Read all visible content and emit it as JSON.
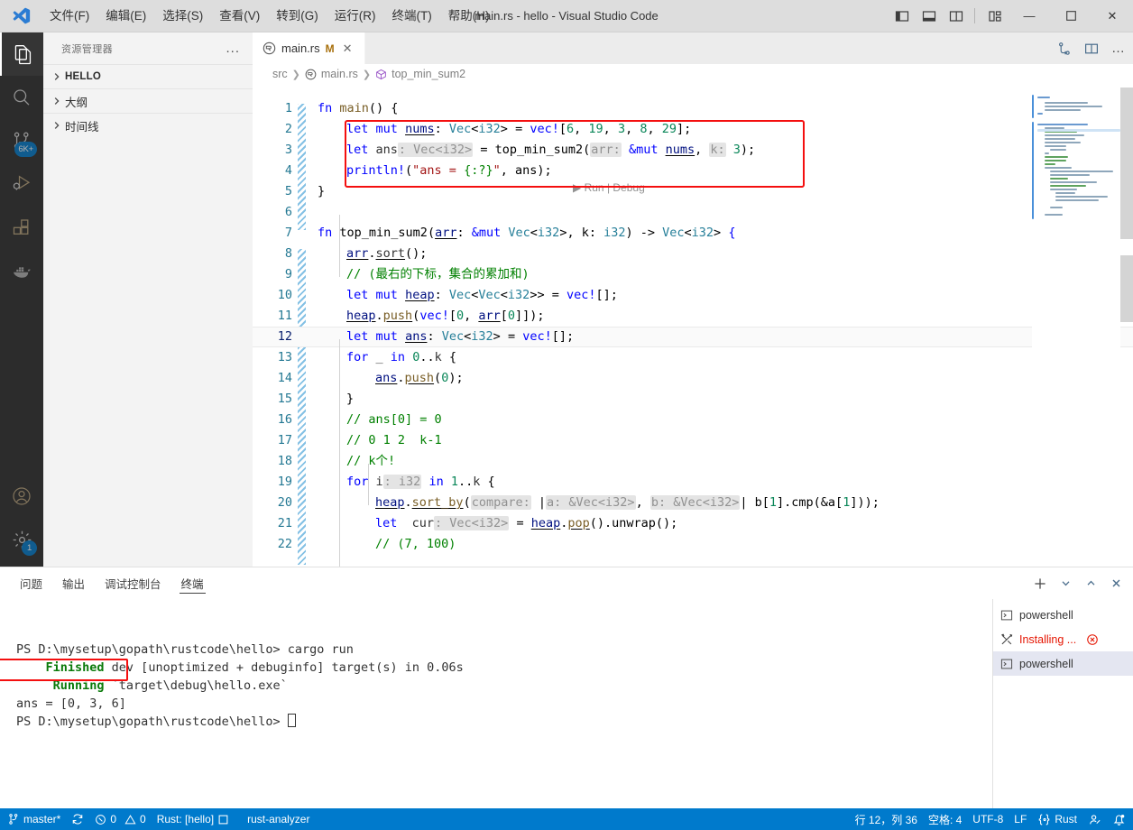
{
  "titlebar": {
    "window_title": "main.rs - hello - Visual Studio Code",
    "logo_icon": "vscode-logo-icon",
    "menus": [
      {
        "label": "文件(F)",
        "name": "menu-file"
      },
      {
        "label": "编辑(E)",
        "name": "menu-edit"
      },
      {
        "label": "选择(S)",
        "name": "menu-selection"
      },
      {
        "label": "查看(V)",
        "name": "menu-view"
      },
      {
        "label": "转到(G)",
        "name": "menu-go"
      },
      {
        "label": "运行(R)",
        "name": "menu-run"
      },
      {
        "label": "终端(T)",
        "name": "menu-terminal"
      },
      {
        "label": "帮助(H)",
        "name": "menu-help"
      }
    ],
    "layout_buttons": [
      "toggle-primary-sidebar-icon",
      "toggle-panel-icon",
      "toggle-secondary-sidebar-icon",
      "customize-layout-icon"
    ],
    "window_controls": {
      "minimize": "—",
      "maximize": "▢",
      "close": "✕"
    }
  },
  "activitybar": {
    "items": [
      {
        "name": "activity-explorer",
        "icon": "files-icon",
        "active": true
      },
      {
        "name": "activity-search",
        "icon": "search-icon",
        "active": false
      },
      {
        "name": "activity-source-control",
        "icon": "source-control-icon",
        "active": false,
        "badge": "6K+"
      },
      {
        "name": "activity-run-debug",
        "icon": "run-and-debug-icon",
        "active": false
      },
      {
        "name": "activity-extensions",
        "icon": "extensions-icon",
        "active": false
      },
      {
        "name": "activity-docker",
        "icon": "docker-whale-icon",
        "active": false
      },
      {
        "name": "activity-accounts",
        "icon": "account-icon",
        "active": false
      },
      {
        "name": "activity-settings",
        "icon": "gear-icon",
        "active": false,
        "badge": "1"
      }
    ]
  },
  "sidebar": {
    "title": "资源管理器",
    "more_actions": "...",
    "sections": [
      {
        "label": "HELLO",
        "expanded": false,
        "bold": true
      },
      {
        "label": "大纲",
        "expanded": false,
        "bold": false
      },
      {
        "label": "时间线",
        "expanded": false,
        "bold": false
      }
    ]
  },
  "editor": {
    "tab": {
      "filename": "main.rs",
      "modified_badge": "M",
      "close": "✕",
      "icon": "rust-file-icon"
    },
    "tab_actions": [
      "open-changes-icon",
      "split-editor-icon",
      "more-actions-icon"
    ],
    "breadcrumbs": [
      {
        "label": "src",
        "icon": ""
      },
      {
        "label": "main.rs",
        "icon": "rust-file-icon"
      },
      {
        "label": "top_min_sum2",
        "icon": "function-symbol-icon"
      }
    ],
    "codelens": {
      "run": "Run",
      "separator": "|",
      "debug": "Debug"
    },
    "highlight_box_color": "#f40f0f",
    "current_line": 12,
    "lines": [
      {
        "n": 1,
        "indent": 0,
        "html": "<span class=\"kw\">fn</span> <span class=\"fnm\">main</span><span class=\"pun\">() {</span>"
      },
      {
        "n": 2,
        "indent": 1,
        "html": "<span class=\"kw\">let</span> <span class=\"kw\">mut</span> <span class=\"var unsafe-u\">nums</span><span class=\"pun\">:</span> <span class=\"ty\">Vec</span><span class=\"pun\">&lt;</span><span class=\"ty\">i32</span><span class=\"pun\">&gt;</span> <span class=\"op\">=</span> <span class=\"mac\">vec!</span><span class=\"pun\">[</span><span class=\"num\">6</span><span class=\"pun\">, </span><span class=\"num\">19</span><span class=\"pun\">, </span><span class=\"num\">3</span><span class=\"pun\">, </span><span class=\"num\">8</span><span class=\"pun\">, </span><span class=\"num\">29</span><span class=\"pun\">];</span>"
      },
      {
        "n": 3,
        "indent": 1,
        "html": "<span class=\"kw\">let</span> ans<span class=\"hint\">: Vec&lt;i32&gt;</span> <span class=\"op\">=</span> <span class=\"pun\">top_min_sum2(</span><span class=\"hint\">arr:</span> <span class=\"kw\">&amp;mut</span> <span class=\"var unsafe-u\">nums</span><span class=\"pun\">, </span><span class=\"hint\">k:</span> <span class=\"num\">3</span><span class=\"pun\">);</span>"
      },
      {
        "n": 4,
        "indent": 1,
        "html": "<span class=\"mac\">println!</span><span class=\"pun\">(</span><span class=\"str\">\"ans = </span><span class=\"cmt\">{:?}</span><span class=\"str\">\"</span><span class=\"pun\">, ans);</span>"
      },
      {
        "n": 5,
        "indent": 0,
        "html": "<span class=\"pun\">}</span>"
      },
      {
        "n": 6,
        "indent": 0,
        "html": ""
      },
      {
        "n": 7,
        "indent": 0,
        "html": "<span class=\"kw\">fn</span> <span class=\"pun\">top_min_sum2(</span><span class=\"var unsafe-u\">arr</span><span class=\"pun\">: </span><span class=\"kw\">&amp;mut</span> <span class=\"ty\">Vec</span><span class=\"pun\">&lt;</span><span class=\"ty\">i32</span><span class=\"pun\">&gt;, k: </span><span class=\"ty\">i32</span><span class=\"pun\">) -&gt; </span><span class=\"ty\">Vec</span><span class=\"pun\">&lt;</span><span class=\"ty\">i32</span><span class=\"pun\">&gt; </span><span class=\"kwc\">{</span>"
      },
      {
        "n": 8,
        "indent": 1,
        "html": "<span class=\"var unsafe-u\">arr</span><span class=\"pun\">.</span><span class=\"unsafe-u\">sort</span><span class=\"pun\">();</span>"
      },
      {
        "n": 9,
        "indent": 1,
        "html": "<span class=\"cmt\">// (最右的下标，集合的累加和)</span>"
      },
      {
        "n": 10,
        "indent": 1,
        "html": "<span class=\"kw\">let</span> <span class=\"kw\">mut</span> <span class=\"var unsafe-u\">heap</span><span class=\"pun\">:</span> <span class=\"ty\">Vec</span><span class=\"pun\">&lt;</span><span class=\"ty\">Vec</span><span class=\"pun\">&lt;</span><span class=\"ty\">i32</span><span class=\"pun\">&gt;&gt;</span> <span class=\"op\">=</span> <span class=\"mac\">vec!</span><span class=\"pun\">[];</span>"
      },
      {
        "n": 11,
        "indent": 1,
        "html": "<span class=\"var unsafe-u\">heap</span><span class=\"pun\">.</span><span class=\"fnm unsafe-u\">push</span><span class=\"pun\">(</span><span class=\"mac\">vec!</span><span class=\"pun\">[</span><span class=\"num\">0</span><span class=\"pun\">, </span><span class=\"var unsafe-u\">arr</span><span class=\"pun\">[</span><span class=\"num\">0</span><span class=\"pun\">]]);</span>"
      },
      {
        "n": 12,
        "indent": 1,
        "html": "<span class=\"kw\">let</span> <span class=\"kw\">mut</span> <span class=\"var unsafe-u\">ans</span><span class=\"pun\">:</span> <span class=\"ty\">Vec</span><span class=\"pun\">&lt;</span><span class=\"ty\">i32</span><span class=\"pun\">&gt;</span> <span class=\"op\">=</span> <span class=\"mac\">vec!</span><span class=\"pun\">[];</span>"
      },
      {
        "n": 13,
        "indent": 1,
        "html": "<span class=\"kw\">for</span> _ <span class=\"kw\">in</span> <span class=\"num\">0</span><span class=\"pun\">..</span>k <span class=\"pun\">{</span>"
      },
      {
        "n": 14,
        "indent": 2,
        "html": "<span class=\"var unsafe-u\">ans</span><span class=\"pun\">.</span><span class=\"fnm unsafe-u\">push</span><span class=\"pun\">(</span><span class=\"num\">0</span><span class=\"pun\">);</span>"
      },
      {
        "n": 15,
        "indent": 1,
        "html": "<span class=\"pun\">}</span>"
      },
      {
        "n": 16,
        "indent": 1,
        "html": "<span class=\"cmt\">// ans[0] = 0</span>"
      },
      {
        "n": 17,
        "indent": 1,
        "html": "<span class=\"cmt\">// 0 1 2  k-1</span>"
      },
      {
        "n": 18,
        "indent": 1,
        "html": "<span class=\"cmt\">// k个!</span>"
      },
      {
        "n": 19,
        "indent": 1,
        "html": "<span class=\"kw\">for</span> i<span class=\"hint\">: i32</span> <span class=\"kw\">in</span> <span class=\"num\">1</span><span class=\"pun\">..</span>k <span class=\"pun\">{</span>"
      },
      {
        "n": 20,
        "indent": 2,
        "html": "<span class=\"var unsafe-u\">heap</span><span class=\"pun\">.</span><span class=\"fnm unsafe-u\">sort_by</span><span class=\"pun\">(</span><span class=\"hint\">compare:</span> <span class=\"pun\">|</span><span class=\"hint\">a: &amp;Vec&lt;i32&gt;</span><span class=\"pun\">, </span><span class=\"hint\">b: &amp;Vec&lt;i32&gt;</span><span class=\"pun\">| b[</span><span class=\"num\">1</span><span class=\"pun\">].cmp(&amp;a[</span><span class=\"num\">1</span><span class=\"pun\">]));</span>"
      },
      {
        "n": 21,
        "indent": 2,
        "html": "<span class=\"kw\">let</span>  cur<span class=\"hint\">: Vec&lt;i32&gt;</span> <span class=\"op\">=</span> <span class=\"var unsafe-u\">heap</span><span class=\"pun\">.</span><span class=\"fnm unsafe-u\">pop</span><span class=\"pun\">().unwrap();</span>"
      },
      {
        "n": 22,
        "indent": 2,
        "html": "<span class=\"cmt\">// (7, 100)</span>"
      }
    ]
  },
  "panel": {
    "tabs": [
      {
        "label": "问题",
        "name": "panel-tab-problems",
        "active": false
      },
      {
        "label": "输出",
        "name": "panel-tab-output",
        "active": false
      },
      {
        "label": "调试控制台",
        "name": "panel-tab-debug-console",
        "active": false
      },
      {
        "label": "终端",
        "name": "panel-tab-terminal",
        "active": true
      }
    ],
    "actions": [
      "new-terminal-icon",
      "chevron-down-icon",
      "maximize-panel-icon",
      "close-panel-icon"
    ],
    "terminal_lines": [
      {
        "segments": [
          {
            "t": "PS D:\\mysetup\\gopath\\rustcode\\hello> cargo run",
            "c": ""
          }
        ]
      },
      {
        "segments": [
          {
            "t": "    ",
            "c": ""
          },
          {
            "t": "Finished",
            "c": "t-green"
          },
          {
            "t": " dev [unoptimized + debuginfo] target(s) in 0.06s",
            "c": ""
          }
        ]
      },
      {
        "segments": [
          {
            "t": "     ",
            "c": ""
          },
          {
            "t": "Running",
            "c": "t-green"
          },
          {
            "t": " `target\\debug\\hello.exe`",
            "c": ""
          }
        ]
      },
      {
        "segments": [
          {
            "t": "ans = [0, 3, 6]",
            "c": ""
          }
        ]
      },
      {
        "segments": [
          {
            "t": "PS D:\\mysetup\\gopath\\rustcode\\hello> ",
            "c": ""
          }
        ]
      }
    ],
    "terminal_instances": [
      {
        "label": "powershell",
        "icon": "terminal-icon",
        "selected": false,
        "error": false
      },
      {
        "label": "Installing ...",
        "icon": "tools-icon",
        "selected": false,
        "error": true,
        "action_icon": "cancel-icon"
      },
      {
        "label": "powershell",
        "icon": "terminal-icon",
        "selected": true,
        "error": false
      }
    ]
  },
  "statusbar": {
    "background": "#007acc",
    "left": [
      {
        "label": "master*",
        "icon": "source-control-branch-icon",
        "name": "status-branch"
      },
      {
        "label": "",
        "icon": "sync-icon",
        "name": "status-sync"
      },
      {
        "label": "0",
        "icon": "error-icon",
        "label2": "0",
        "icon2": "warning-icon",
        "name": "status-problems"
      },
      {
        "label": "Rust: [hello]",
        "icon": "",
        "icon_after": "square-icon",
        "name": "status-rust-project"
      },
      {
        "label": "rust-analyzer",
        "icon": "",
        "name": "status-rust-analyzer"
      }
    ],
    "right": [
      {
        "label": "行 12，列 36",
        "name": "status-cursor-position"
      },
      {
        "label": "空格: 4",
        "name": "status-indentation"
      },
      {
        "label": "UTF-8",
        "name": "status-encoding"
      },
      {
        "label": "LF",
        "name": "status-eol"
      },
      {
        "label": "Rust",
        "icon": "braces-icon",
        "name": "status-language-mode"
      },
      {
        "label": "",
        "icon": "feedback-icon",
        "name": "status-feedback"
      },
      {
        "label": "",
        "icon": "bell-dot-icon",
        "name": "status-notifications"
      }
    ]
  }
}
